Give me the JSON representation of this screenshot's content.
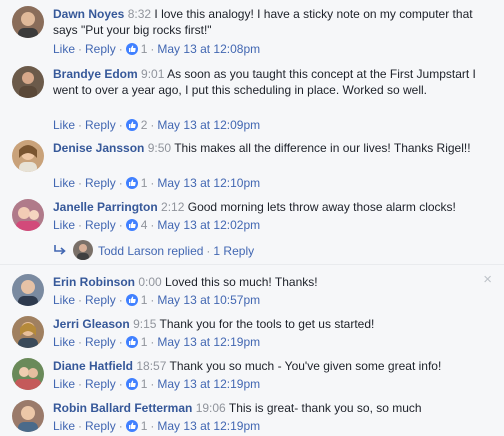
{
  "actions": {
    "like": "Like",
    "reply": "Reply",
    "sep": "·"
  },
  "comments": [
    {
      "name": "Dawn Noyes",
      "time": "8:32",
      "text": "I love this analogy! I have a sticky note on my computer that says \"Put your big rocks first!\"",
      "likes": "1",
      "date": "May 13 at 12:08pm",
      "avatar_color": "#8a6d5a"
    },
    {
      "name": "Brandye Edom",
      "time": "9:01",
      "text": "As soon as you taught this concept at the First Jumpstart I went to over a year ago, I put this scheduling in place. Worked so well.",
      "likes": "2",
      "date": "May 13 at 12:09pm",
      "avatar_color": "#6b5a4a"
    },
    {
      "name": "Denise Jansson",
      "time": "9:50",
      "text": "This makes all the difference in our lives! Thanks Rigel!!",
      "likes": "1",
      "date": "May 13 at 12:10pm",
      "avatar_color": "#c9a27a"
    },
    {
      "name": "Janelle Parrington",
      "time": "2:12",
      "text": "Good morning lets throw away those alarm clocks!",
      "likes": "4",
      "date": "May 13 at 12:02pm",
      "avatar_color": "#b07a8a"
    },
    {
      "name": "Erin Robinson",
      "time": "0:00",
      "text": "Loved this so much! Thanks!",
      "likes": "1",
      "date": "May 13 at 10:57pm",
      "avatar_color": "#7a8aa0"
    },
    {
      "name": "Jerri Gleason",
      "time": "9:15",
      "text": "Thank you for the tools to get us started!",
      "likes": "1",
      "date": "May 13 at 12:19pm",
      "avatar_color": "#a08060"
    },
    {
      "name": "Diane Hatfield",
      "time": "18:57",
      "text": "Thank you so much - You've given some great info!",
      "likes": "1",
      "date": "May 13 at 12:19pm",
      "avatar_color": "#6a8a5a"
    },
    {
      "name": "Robin Ballard Fetterman",
      "time": "19:06",
      "text": "This is great- thank you so, so much",
      "likes": "1",
      "date": "May 13 at 12:19pm",
      "avatar_color": "#9a7a6a"
    }
  ],
  "reply_summary": {
    "name": "Todd Larson",
    "verb": "replied",
    "count": "1 Reply"
  },
  "close_icon": "×"
}
